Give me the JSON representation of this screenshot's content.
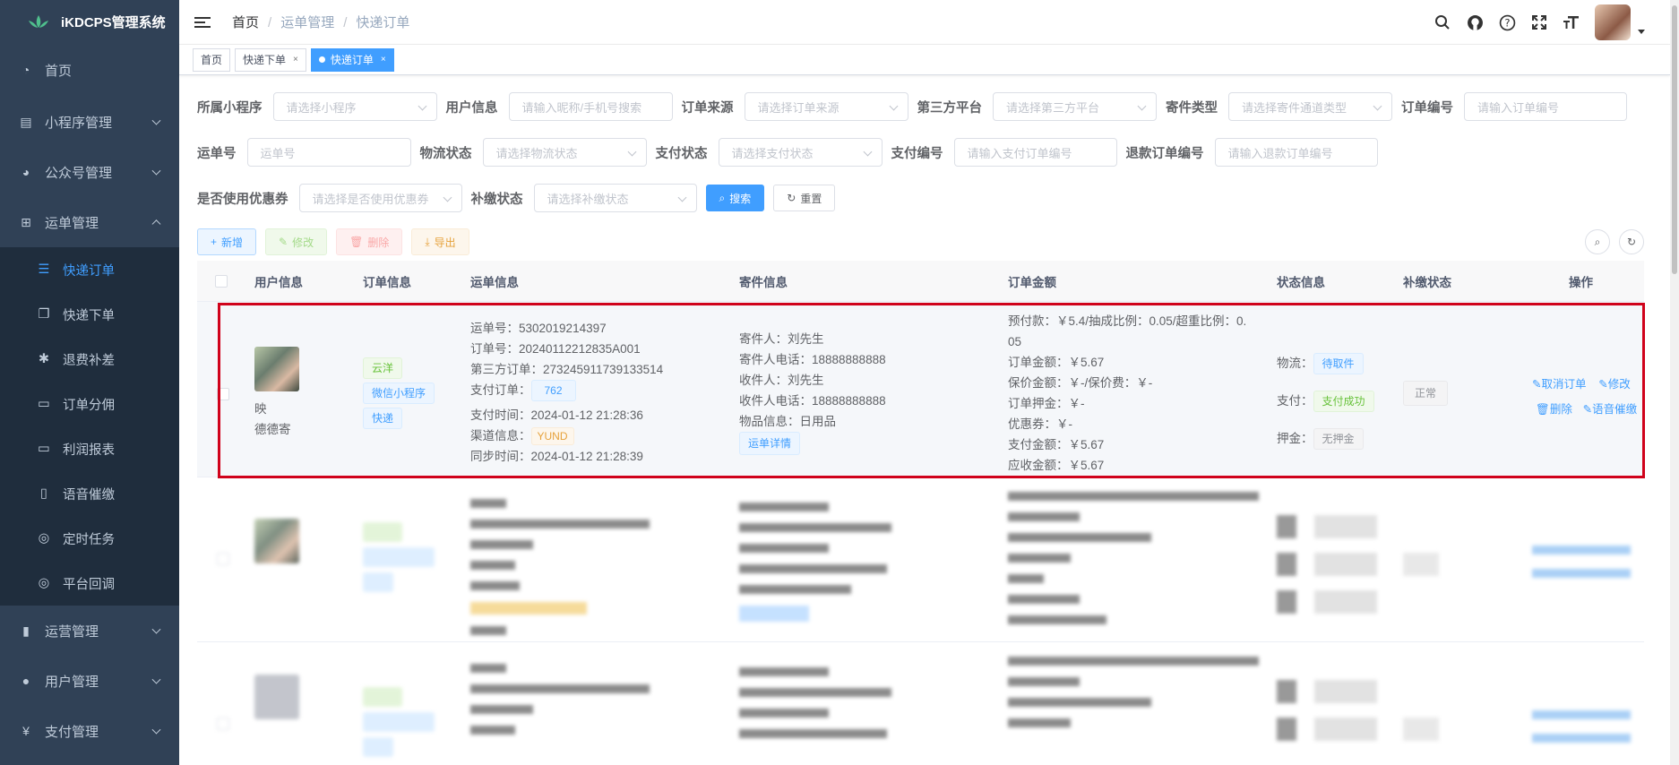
{
  "app": {
    "title": "iKDCPS管理系统"
  },
  "sidebar": {
    "items": [
      {
        "label": "首页",
        "icon": "dashboard-icon"
      },
      {
        "label": "小程序管理",
        "icon": "miniprogram-icon"
      },
      {
        "label": "公众号管理",
        "icon": "wechat-icon"
      },
      {
        "label": "运单管理",
        "icon": "grid-icon"
      }
    ],
    "submenu": [
      {
        "label": "快递订单",
        "icon": "list-icon"
      },
      {
        "label": "快递下单",
        "icon": "copy-icon"
      },
      {
        "label": "退费补差",
        "icon": "bug-icon"
      },
      {
        "label": "订单分佣",
        "icon": "monitor-icon"
      },
      {
        "label": "利润报表",
        "icon": "monitor-icon"
      },
      {
        "label": "语音催缴",
        "icon": "phone-icon"
      },
      {
        "label": "定时任务",
        "icon": "timer-icon"
      },
      {
        "label": "平台回调",
        "icon": "callback-icon"
      }
    ],
    "bottom": [
      {
        "label": "运营管理",
        "icon": "chart-icon"
      },
      {
        "label": "用户管理",
        "icon": "user-icon"
      },
      {
        "label": "支付管理",
        "icon": "yen-icon"
      }
    ]
  },
  "breadcrumb": {
    "home": "首页",
    "level1": "运单管理",
    "level2": "快递订单",
    "sep": "/"
  },
  "tags": {
    "home": "首页",
    "tab1": "快递下单",
    "tab2": "快递订单",
    "close": "×"
  },
  "filters": {
    "miniprogram": {
      "label": "所属小程序",
      "placeholder": "请选择小程序"
    },
    "user": {
      "label": "用户信息",
      "placeholder": "请输入昵称/手机号搜索"
    },
    "source": {
      "label": "订单来源",
      "placeholder": "请选择订单来源"
    },
    "platform": {
      "label": "第三方平台",
      "placeholder": "请选择第三方平台"
    },
    "send_type": {
      "label": "寄件类型",
      "placeholder": "请选择寄件通道类型"
    },
    "order_no": {
      "label": "订单编号",
      "placeholder": "请输入订单编号"
    },
    "waybill": {
      "label": "运单号",
      "placeholder": "运单号"
    },
    "logistics": {
      "label": "物流状态",
      "placeholder": "请选择物流状态"
    },
    "pay_status": {
      "label": "支付状态",
      "placeholder": "请选择支付状态"
    },
    "pay_no": {
      "label": "支付编号",
      "placeholder": "请输入支付订单编号"
    },
    "refund_no": {
      "label": "退款订单编号",
      "placeholder": "请输入退款订单编号"
    },
    "coupon": {
      "label": "是否使用优惠券",
      "placeholder": "请选择是否使用优惠券"
    },
    "supplement": {
      "label": "补缴状态",
      "placeholder": "请选择补缴状态"
    },
    "search_btn": "搜索",
    "reset_btn": "重置"
  },
  "toolbar": {
    "add": "新增",
    "edit": "修改",
    "delete": "删除",
    "export": "导出"
  },
  "table": {
    "headers": [
      "用户信息",
      "订单信息",
      "运单信息",
      "寄件信息",
      "订单金额",
      "状态信息",
      "补缴状态",
      "操作"
    ],
    "row1": {
      "user_line1": "映",
      "user_line2": "德德寄",
      "order_tags": [
        "云洋",
        "微信小程序",
        "快递"
      ],
      "waybill": {
        "waybill_no": "运单号：5302019214397",
        "order_no": "订单号：20240112212835A001",
        "third_order": "第三方订单：273245911739133514",
        "pay_order_label": "支付订单：",
        "pay_order_tag": "762",
        "pay_time": "支付时间：2024-01-12 21:28:36",
        "channel_label": "渠道信息：",
        "channel_tag": "YUND",
        "sync_time": "同步时间：2024-01-12 21:28:39"
      },
      "sender": {
        "sender": "寄件人：刘先生",
        "sender_phone": "寄件人电话：18888888888",
        "receiver": "收件人：刘先生",
        "receiver_phone": "收件人电话：18888888888",
        "goods": "物品信息：日用品",
        "detail_btn": "运单详情"
      },
      "amount": {
        "prepay_a": "预付款：￥5.4/抽成比例：0.05/超重比例：0.",
        "prepay_b": "05",
        "order_amount": "订单金额：￥5.67",
        "insure": "保价金额：￥-/保价费：￥-",
        "deposit": "订单押金：￥-",
        "coupon": "优惠券：￥-",
        "paid": "支付金额：￥5.67",
        "receivable": "应收金额：￥5.67"
      },
      "status": {
        "logistics_label": "物流：",
        "logistics_tag": "待取件",
        "pay_label": "支付：",
        "pay_tag": "支付成功",
        "deposit_label": "押金：",
        "deposit_tag": "无押金"
      },
      "supplement_tag": "正常",
      "actions": {
        "cancel": "取消订单",
        "edit": "修改",
        "delete": "删除",
        "voice": "语音催缴"
      }
    }
  },
  "colors": {
    "sidebar_bg": "#304156",
    "primary": "#409eff",
    "highlight": "#d0021b"
  }
}
